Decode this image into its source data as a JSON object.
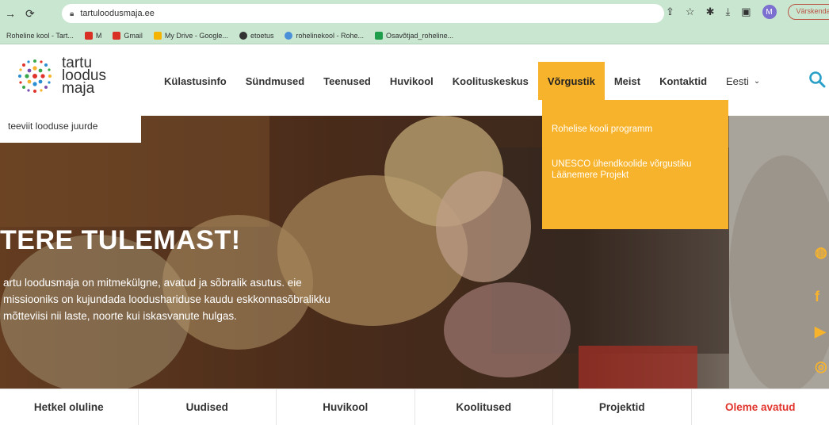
{
  "browser": {
    "url": "tartuloodusmaja.ee",
    "refresh_label": "Värskenda",
    "profile_initial": "M",
    "bookmarks": [
      {
        "label": "Roheline kool - Tart...",
        "color": ""
      },
      {
        "label": "M",
        "color": "#d93025"
      },
      {
        "label": "Gmail",
        "color": "#d93025"
      },
      {
        "label": "My Drive - Google...",
        "color": "#f4b400"
      },
      {
        "label": "etoetus",
        "color": "#333333"
      },
      {
        "label": "rohelinekool - Rohe...",
        "color": "#4a90d9"
      },
      {
        "label": "Osavõtjad_roheline...",
        "color": "#1e9e4a"
      }
    ]
  },
  "logo": {
    "line1": "tartu",
    "line2": "loodus",
    "line3": "maja"
  },
  "nav": {
    "items": [
      "Külastusinfo",
      "Sündmused",
      "Teenused",
      "Huvikool",
      "Koolituskeskus",
      "Võrgustik",
      "Meist",
      "Kontaktid"
    ],
    "active_index": 5,
    "language": "Eesti"
  },
  "tagline": "teeviit looduse juurde",
  "dropdown": {
    "items": [
      "Rohelise kooli programm",
      "UNESCO ühendkoolide võrgustiku Läänemere Projekt"
    ]
  },
  "hero": {
    "title": "TERE TULEMAST!",
    "body": "artu loodusmaja on mitmekülgne, avatud ja sõbralik asutus. eie missiooniks on kujundada loodushariduse kaudu eskkonnasõbralikku mõtteviisi nii laste, noorte kui iskasvanute hulgas."
  },
  "tabs": [
    "Hetkel oluline",
    "Uudised",
    "Huvikool",
    "Koolitused",
    "Projektid",
    "Oleme avatud"
  ],
  "colors": {
    "accent": "#f7b32b",
    "highlight": "#e0332b",
    "browser_chrome": "#c8e6d0"
  }
}
